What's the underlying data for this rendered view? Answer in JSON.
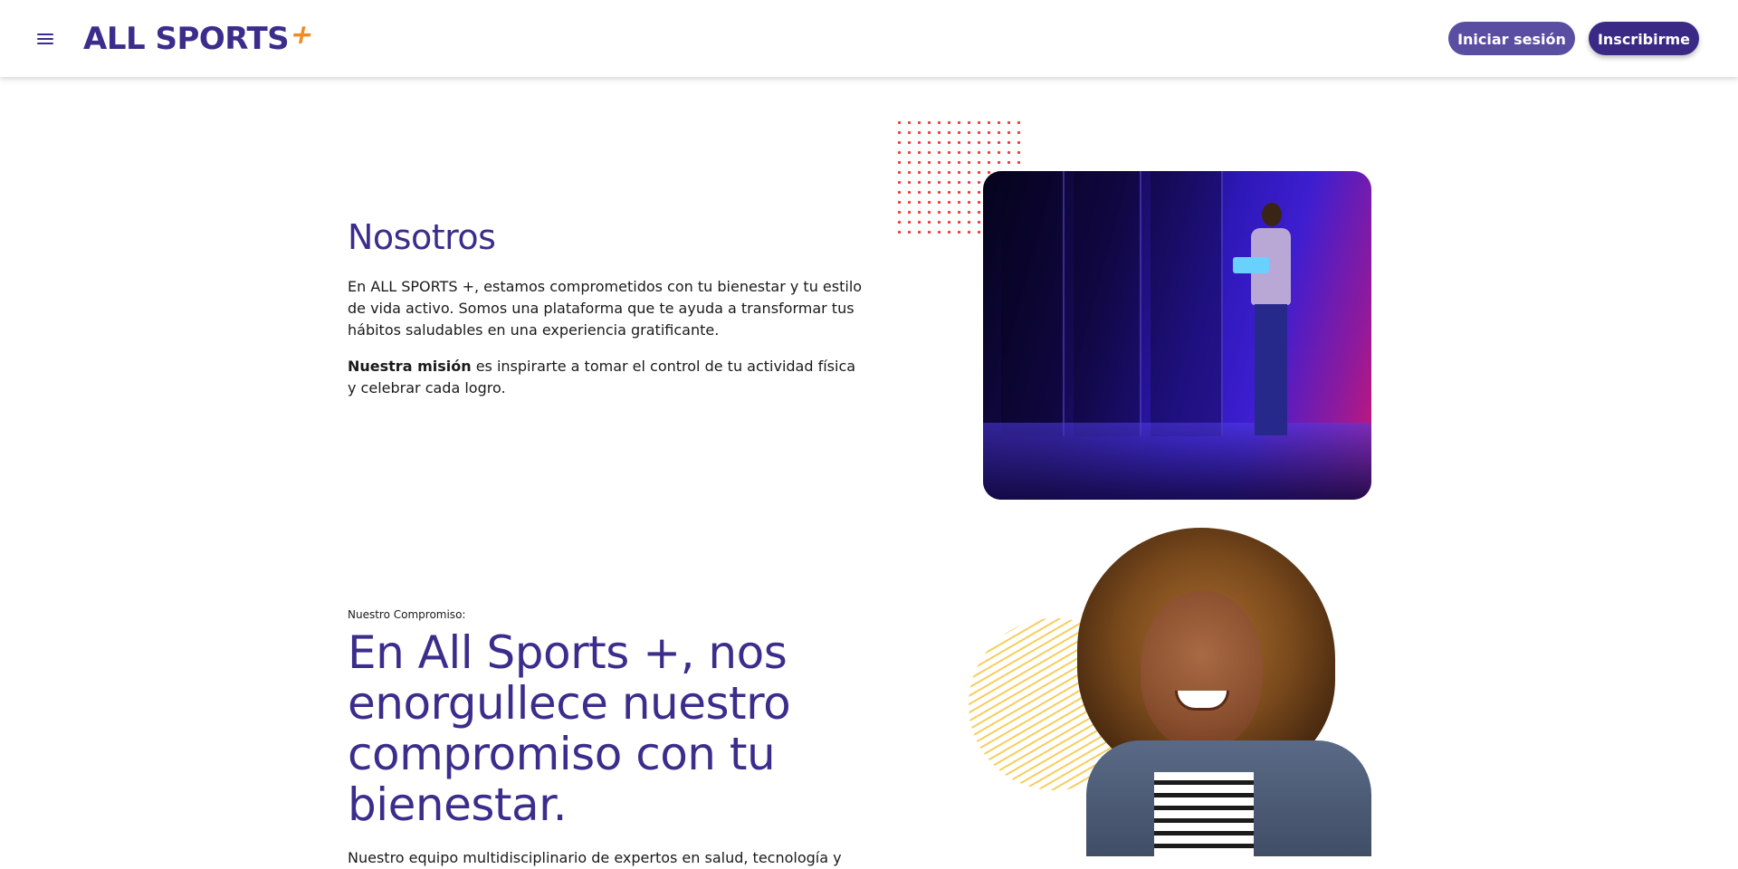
{
  "header": {
    "menu_icon": "hamburger-menu-icon",
    "logo": {
      "text": "ALL SPORTS",
      "plus": "+"
    },
    "login_label": "Iniciar sesión",
    "signup_label": "Inscribirme"
  },
  "about": {
    "title": "Nosotros",
    "paragraph": "En ALL SPORTS +, estamos comprometidos con tu bienestar y tu estilo de vida activo. Somos una plataforma que te ayuda a transformar tus hábitos saludables en una experiencia gratificante.",
    "mission_bold": "Nuestra misión",
    "mission_rest": " es inspirarte a tomar el control de tu actividad física y celebrar cada logro."
  },
  "commitment": {
    "kicker": "Nuestro Compromiso:",
    "title": "En All Sports +, nos enorgullece nuestro compromiso con tu bienestar.",
    "paragraph_partial": "Nuestro equipo multidisciplinario de expertos en salud, tecnología y"
  },
  "colors": {
    "brand_purple": "#3b2d8c",
    "login_button": "#5a4ea3",
    "signup_button": "#3a2a86",
    "logo_plus": "#f28b1f",
    "dots": "#ef3b3b",
    "stripes": "#f5c94a"
  }
}
